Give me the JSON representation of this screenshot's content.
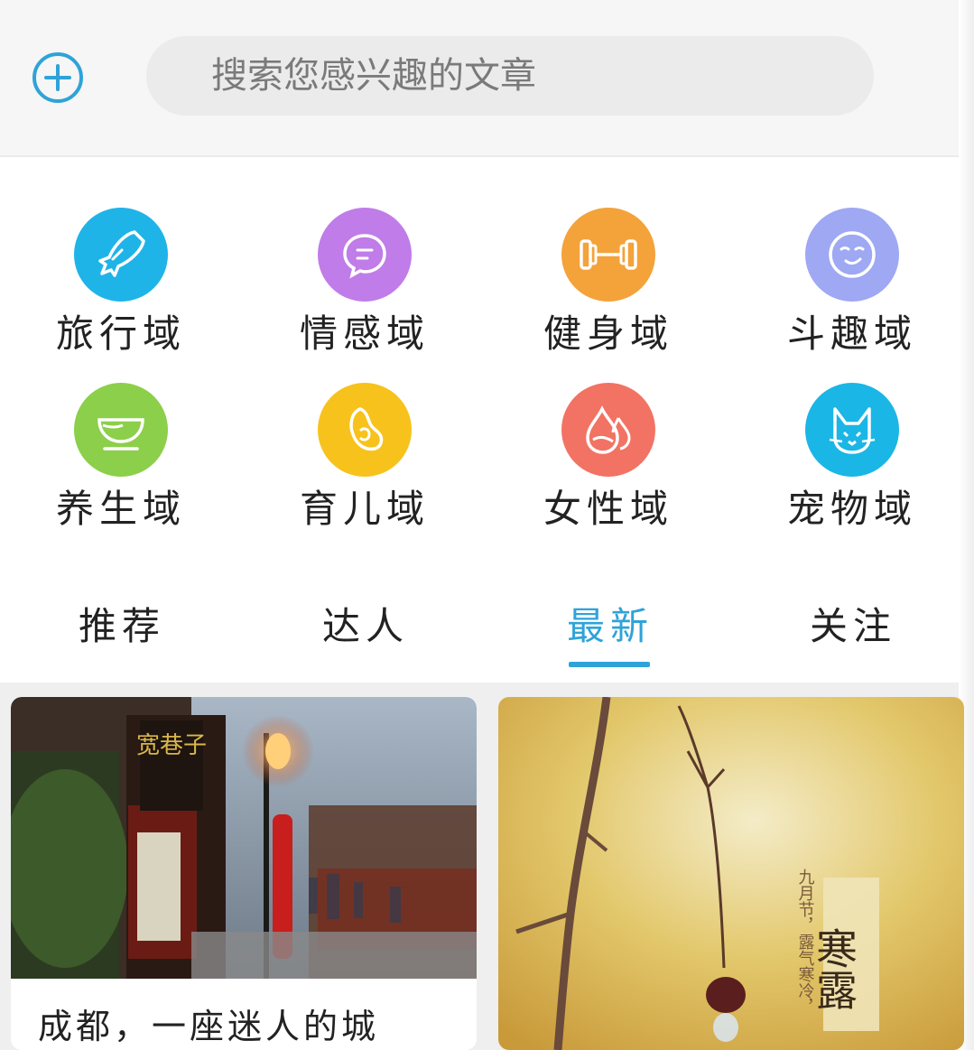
{
  "search": {
    "placeholder": "搜索您感兴趣的文章"
  },
  "categories": [
    {
      "label": "旅行域",
      "icon": "airplane-icon",
      "color": "#1fb4e8"
    },
    {
      "label": "情感域",
      "icon": "chat-bubble-icon",
      "color": "#c07ce8"
    },
    {
      "label": "健身域",
      "icon": "dumbbell-icon",
      "color": "#f4a23a"
    },
    {
      "label": "斗趣域",
      "icon": "smirk-face-icon",
      "color": "#9ea8f3"
    },
    {
      "label": "养生域",
      "icon": "teacup-icon",
      "color": "#8ccf4a"
    },
    {
      "label": "育儿域",
      "icon": "baby-icon",
      "color": "#f7c21c"
    },
    {
      "label": "女性域",
      "icon": "water-drop-icon",
      "color": "#f27363"
    },
    {
      "label": "宠物域",
      "icon": "cat-face-icon",
      "color": "#1ab6e6"
    }
  ],
  "tabs": [
    {
      "label": "推荐"
    },
    {
      "label": "达人"
    },
    {
      "label": "最新",
      "active": true
    },
    {
      "label": "关注"
    }
  ],
  "cards": [
    {
      "title": "成都，一座迷人的城",
      "sign_text": "宽巷子"
    },
    {
      "title": "",
      "poster_title": "寒露",
      "poster_sub": "九月节，露气寒冷，"
    }
  ],
  "colors": {
    "accent": "#2fa3d8"
  }
}
